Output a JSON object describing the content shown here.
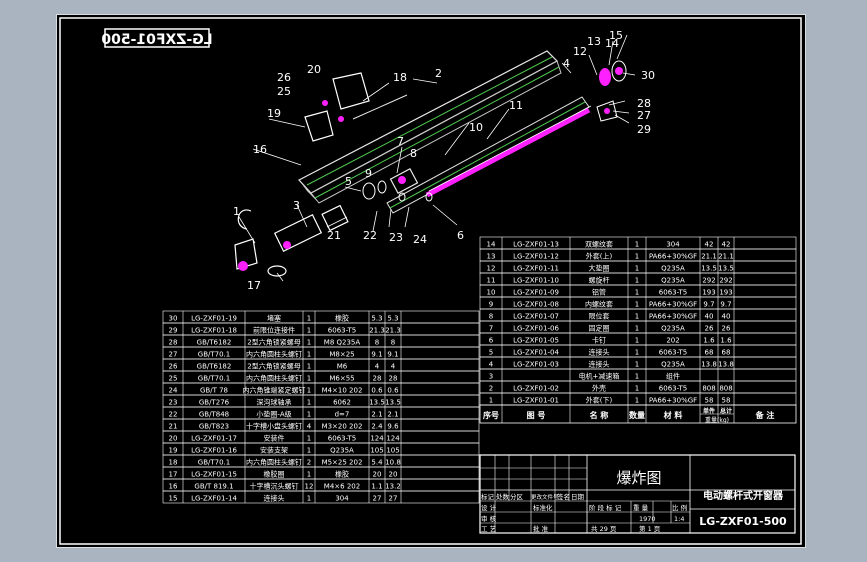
{
  "drawing": {
    "mirrored_code": "LG-ZXF01-500",
    "title": "爆炸图",
    "product_name": "电动螺杆式开窗器",
    "drawing_number": "LG-ZXF01-500",
    "title_block": {
      "scale_label": "比 例",
      "scale_value": "1:4",
      "weight_label": "重 量",
      "weight_value": "1970",
      "sheet_total_label": "共 29 页",
      "sheet_label": "第 1 页",
      "stage_label": "阶 段 标 记",
      "design_label": "设 计",
      "standardize_label": "标准化",
      "review_label": "审 核",
      "process_label": "工 艺",
      "approve_label": "批 准",
      "date_label": "日期",
      "sign_label": "签名",
      "mark_label": "标记",
      "zone_label": "分区",
      "change_doc_label": "更改文件号",
      "count_label": "处数"
    },
    "parts_headers": [
      "序号",
      "图 号",
      "名 称",
      "数量",
      "材 料",
      "单件",
      "总计",
      "备 注"
    ],
    "weight_header": "重量(kg)",
    "parts_right": [
      {
        "no": "14",
        "code": "LG-ZXF01-13",
        "name": "双螺纹套",
        "qty": "1",
        "mat": "304",
        "w1": "42",
        "w2": "42"
      },
      {
        "no": "13",
        "code": "LG-ZXF01-12",
        "name": "外套(上)",
        "qty": "1",
        "mat": "PA66+30%GF",
        "w1": "21.1",
        "w2": "21.1"
      },
      {
        "no": "12",
        "code": "LG-ZXF01-11",
        "name": "大垫圈",
        "qty": "1",
        "mat": "Q235A",
        "w1": "13.5",
        "w2": "13.5"
      },
      {
        "no": "11",
        "code": "LG-ZXF01-10",
        "name": "螺旋杆",
        "qty": "1",
        "mat": "Q235A",
        "w1": "292",
        "w2": "292"
      },
      {
        "no": "10",
        "code": "LG-ZXF01-09",
        "name": "铝管",
        "qty": "1",
        "mat": "6063-T5",
        "w1": "193",
        "w2": "193"
      },
      {
        "no": "9",
        "code": "LG-ZXF01-08",
        "name": "内螺纹套",
        "qty": "1",
        "mat": "PA66+30%GF",
        "w1": "9.7",
        "w2": "9.7"
      },
      {
        "no": "8",
        "code": "LG-ZXF01-07",
        "name": "限位套",
        "qty": "1",
        "mat": "PA66+30%GF",
        "w1": "40",
        "w2": "40"
      },
      {
        "no": "7",
        "code": "LG-ZXF01-06",
        "name": "固定圈",
        "qty": "1",
        "mat": "Q235A",
        "w1": "26",
        "w2": "26"
      },
      {
        "no": "6",
        "code": "LG-ZXF01-05",
        "name": "卡钉",
        "qty": "1",
        "mat": "202",
        "w1": "1.6",
        "w2": "1.6"
      },
      {
        "no": "5",
        "code": "LG-ZXF01-04",
        "name": "连接头",
        "qty": "1",
        "mat": "6063-T5",
        "w1": "68",
        "w2": "68"
      },
      {
        "no": "4",
        "code": "LG-ZXF01-03",
        "name": "连接头",
        "qty": "1",
        "mat": "Q235A",
        "w1": "13.8",
        "w2": "13.8"
      },
      {
        "no": "3",
        "code": "",
        "name": "电机+减速箱",
        "qty": "1",
        "mat": "组件",
        "w1": "",
        "w2": ""
      },
      {
        "no": "2",
        "code": "LG-ZXF01-02",
        "name": "外壳",
        "qty": "1",
        "mat": "6063-T5",
        "w1": "808",
        "w2": "808"
      },
      {
        "no": "1",
        "code": "LG-ZXF01-01",
        "name": "外套(下)",
        "qty": "1",
        "mat": "PA66+30%GF",
        "w1": "58",
        "w2": "58"
      }
    ],
    "parts_left": [
      {
        "no": "30",
        "code": "LG-ZXF01-19",
        "name": "堵塞",
        "qty": "1",
        "mat": "橡胶",
        "w1": "5.3",
        "w2": "5.3"
      },
      {
        "no": "29",
        "code": "LG-ZXF01-18",
        "name": "前限位连接件",
        "qty": "1",
        "mat": "6063-T5",
        "w1": "21.3",
        "w2": "21.3"
      },
      {
        "no": "28",
        "code": "GB/T6182",
        "name": "2型六角锁紧螺母",
        "qty": "1",
        "mat": "M8 Q235A",
        "w1": "8",
        "w2": "8"
      },
      {
        "no": "27",
        "code": "GB/T70.1",
        "name": "内六角圆柱头螺钉",
        "qty": "1",
        "mat": "M8×25",
        "w1": "9.1",
        "w2": "9.1"
      },
      {
        "no": "26",
        "code": "GB/T6182",
        "name": "2型六角锁紧螺母",
        "qty": "1",
        "mat": "M6",
        "w1": "4",
        "w2": "4"
      },
      {
        "no": "25",
        "code": "GB/T70.1",
        "name": "内六角圆柱头螺钉",
        "qty": "1",
        "mat": "M6×55",
        "w1": "28",
        "w2": "28"
      },
      {
        "no": "24",
        "code": "GB/T 78",
        "name": "内六角锥端紧定螺钉",
        "qty": "1",
        "mat": "M4×10 202",
        "w1": "0.6",
        "w2": "0.6"
      },
      {
        "no": "23",
        "code": "GB/T276",
        "name": "深沟球轴承",
        "qty": "1",
        "mat": "6062",
        "w1": "13.5",
        "w2": "13.5"
      },
      {
        "no": "22",
        "code": "GB/T848",
        "name": "小垫圈-A级",
        "qty": "1",
        "mat": "d=7",
        "w1": "2.1",
        "w2": "2.1"
      },
      {
        "no": "21",
        "code": "GB/T823",
        "name": "十字槽小盘头螺钉",
        "qty": "4",
        "mat": "M3×20 202",
        "w1": "2.4",
        "w2": "9.6"
      },
      {
        "no": "20",
        "code": "LG-ZXF01-17",
        "name": "安装件",
        "qty": "1",
        "mat": "6063-T5",
        "w1": "124",
        "w2": "124"
      },
      {
        "no": "19",
        "code": "LG-ZXF01-16",
        "name": "安装支架",
        "qty": "1",
        "mat": "Q235A",
        "w1": "105",
        "w2": "105"
      },
      {
        "no": "18",
        "code": "GB/T70.1",
        "name": "内六角圆柱头螺钉",
        "qty": "2",
        "mat": "M5×25 202",
        "w1": "5.4",
        "w2": "10.8"
      },
      {
        "no": "17",
        "code": "LG-ZXF01-15",
        "name": "橡胶圈",
        "qty": "1",
        "mat": "橡胶",
        "w1": "20",
        "w2": "20"
      },
      {
        "no": "16",
        "code": "GB/T 819.1",
        "name": "十字槽沉头螺钉",
        "qty": "12",
        "mat": "M4×6 202",
        "w1": "1.1",
        "w2": "13.2"
      },
      {
        "no": "15",
        "code": "LG-ZXF01-14",
        "name": "连接头",
        "qty": "1",
        "mat": "304",
        "w1": "27",
        "w2": "27"
      }
    ],
    "balloons": [
      "1",
      "2",
      "3",
      "4",
      "5",
      "6",
      "7",
      "8",
      "9",
      "10",
      "11",
      "12",
      "13",
      "14",
      "15",
      "16",
      "17",
      "18",
      "19",
      "20",
      "21",
      "22",
      "23",
      "24",
      "25",
      "26",
      "27",
      "28",
      "29",
      "30"
    ],
    "colors": {
      "background": "#000000",
      "outer": "#a9b4c0",
      "line_white": "#ffffff",
      "line_green": "#4ec94e",
      "line_yellow": "#e8e84a",
      "magenta": "#ff20ff",
      "table_text": "#ffffff",
      "cyan": "#46e0e0"
    }
  }
}
